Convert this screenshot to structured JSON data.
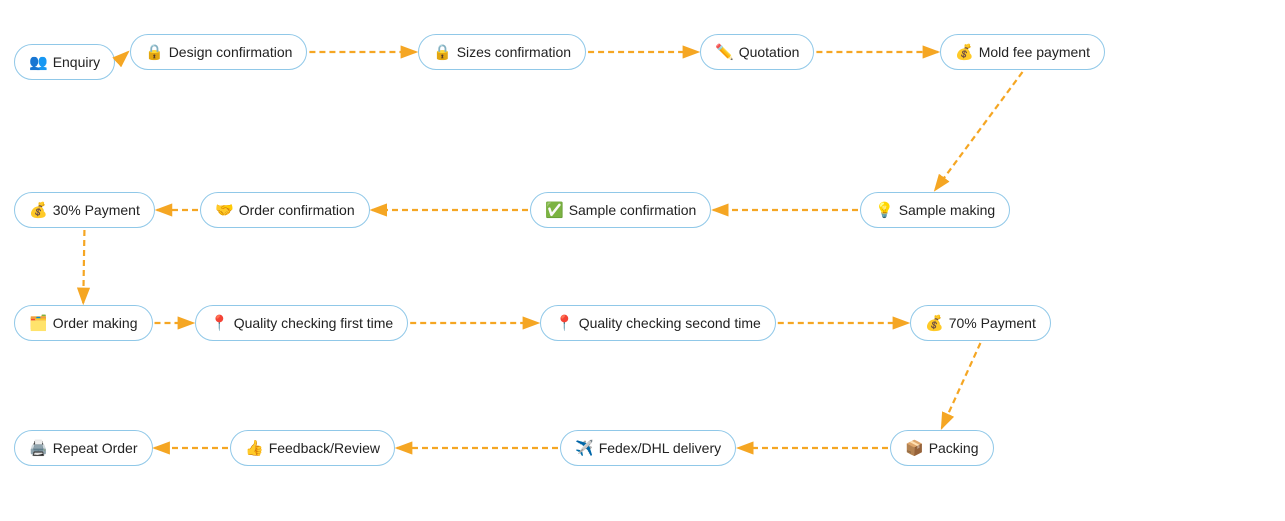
{
  "nodes": {
    "enquiry": {
      "icon": "👥",
      "label": "Enquiry"
    },
    "design": {
      "icon": "🔒",
      "label": "Design confirmation"
    },
    "sizes": {
      "icon": "🔒",
      "label": "Sizes confirmation"
    },
    "quotation": {
      "icon": "✏️",
      "label": "Quotation"
    },
    "mold": {
      "icon": "💰",
      "label": "Mold fee payment"
    },
    "pay30": {
      "icon": "💰",
      "label": "30% Payment"
    },
    "orderconf": {
      "icon": "🤝",
      "label": "Order confirmation"
    },
    "sampleconf": {
      "icon": "✅",
      "label": "Sample confirmation"
    },
    "samplemaking": {
      "icon": "💡",
      "label": "Sample making"
    },
    "ordermaking": {
      "icon": "🗂️",
      "label": "Order making"
    },
    "qc1": {
      "icon": "📍",
      "label": "Quality checking first time"
    },
    "qc2": {
      "icon": "📍",
      "label": "Quality checking second time"
    },
    "pay70": {
      "icon": "💰",
      "label": "70% Payment"
    },
    "repeatorder": {
      "icon": "🖨️",
      "label": "Repeat Order"
    },
    "feedback": {
      "icon": "👍",
      "label": "Feedback/Review"
    },
    "fedex": {
      "icon": "✈️",
      "label": "Fedex/DHL delivery"
    },
    "packing": {
      "icon": "📦",
      "label": "Packing"
    }
  }
}
